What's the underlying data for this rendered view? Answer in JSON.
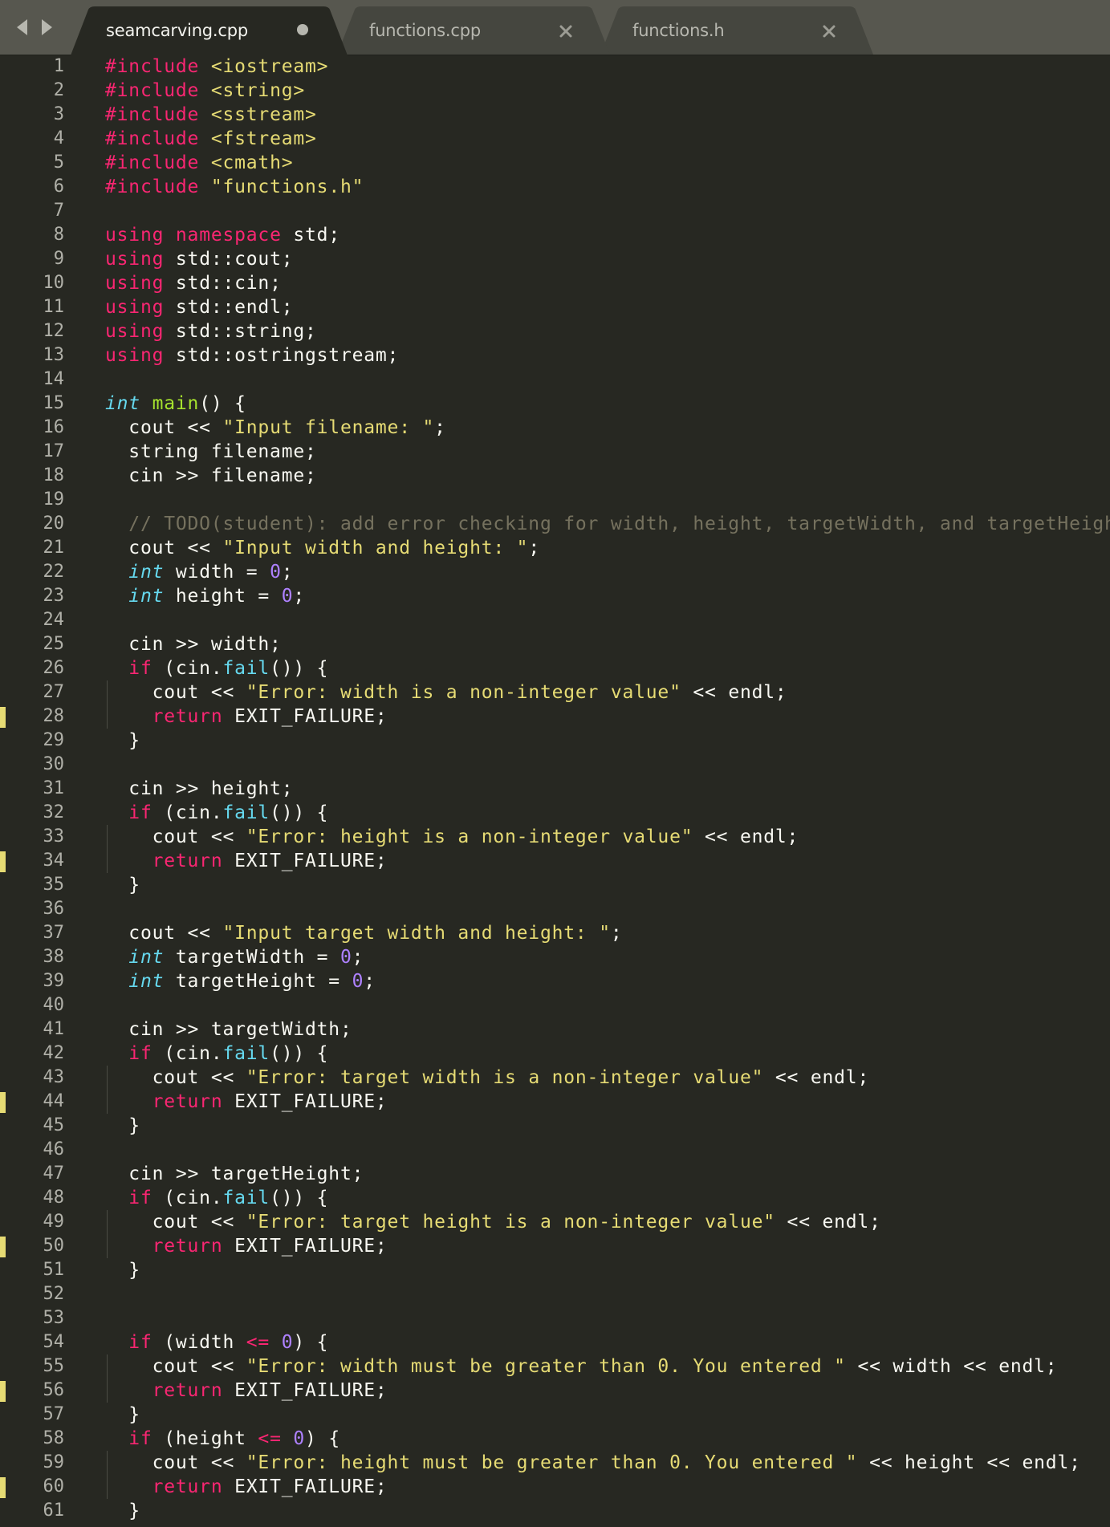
{
  "tabs": [
    {
      "label": "seamcarving.cpp",
      "active": true,
      "modified": true
    },
    {
      "label": "functions.cpp",
      "active": false,
      "modified": false
    },
    {
      "label": "functions.h",
      "active": false,
      "modified": false
    }
  ],
  "nav": {
    "back_icon": "triangle-left-icon",
    "forward_icon": "triangle-right-icon"
  },
  "colors": {
    "background": "#272822",
    "tabbar": "#57574f",
    "keyword": "#f92672",
    "string": "#e6db74",
    "type": "#66d9ef",
    "function": "#a6e22e",
    "number": "#ae81ff",
    "comment": "#75715e",
    "text": "#f8f8f2",
    "modified_marker": "#e6db74"
  },
  "code_lines": [
    {
      "n": "1",
      "mark": false,
      "tokens": [
        [
          "kw",
          "#include"
        ],
        [
          "p",
          " "
        ],
        [
          "str",
          "<iostream>"
        ]
      ]
    },
    {
      "n": "2",
      "mark": false,
      "tokens": [
        [
          "kw",
          "#include"
        ],
        [
          "p",
          " "
        ],
        [
          "str",
          "<string>"
        ]
      ]
    },
    {
      "n": "3",
      "mark": false,
      "tokens": [
        [
          "kw",
          "#include"
        ],
        [
          "p",
          " "
        ],
        [
          "str",
          "<sstream>"
        ]
      ]
    },
    {
      "n": "4",
      "mark": false,
      "tokens": [
        [
          "kw",
          "#include"
        ],
        [
          "p",
          " "
        ],
        [
          "str",
          "<fstream>"
        ]
      ]
    },
    {
      "n": "5",
      "mark": false,
      "tokens": [
        [
          "kw",
          "#include"
        ],
        [
          "p",
          " "
        ],
        [
          "str",
          "<cmath>"
        ]
      ]
    },
    {
      "n": "6",
      "mark": false,
      "tokens": [
        [
          "kw",
          "#include"
        ],
        [
          "p",
          " "
        ],
        [
          "str",
          "\"functions.h\""
        ]
      ]
    },
    {
      "n": "7",
      "mark": false,
      "tokens": []
    },
    {
      "n": "8",
      "mark": false,
      "tokens": [
        [
          "kw",
          "using"
        ],
        [
          "p",
          " "
        ],
        [
          "kw",
          "namespace"
        ],
        [
          "p",
          " std;"
        ]
      ]
    },
    {
      "n": "9",
      "mark": false,
      "tokens": [
        [
          "kw",
          "using"
        ],
        [
          "p",
          " std::cout;"
        ]
      ]
    },
    {
      "n": "10",
      "mark": false,
      "tokens": [
        [
          "kw",
          "using"
        ],
        [
          "p",
          " std::cin;"
        ]
      ]
    },
    {
      "n": "11",
      "mark": false,
      "tokens": [
        [
          "kw",
          "using"
        ],
        [
          "p",
          " std::endl;"
        ]
      ]
    },
    {
      "n": "12",
      "mark": false,
      "tokens": [
        [
          "kw",
          "using"
        ],
        [
          "p",
          " std::string;"
        ]
      ]
    },
    {
      "n": "13",
      "mark": false,
      "tokens": [
        [
          "kw",
          "using"
        ],
        [
          "p",
          " std::ostringstream;"
        ]
      ]
    },
    {
      "n": "14",
      "mark": false,
      "tokens": []
    },
    {
      "n": "15",
      "mark": false,
      "tokens": [
        [
          "type",
          "int"
        ],
        [
          "p",
          " "
        ],
        [
          "fn",
          "main"
        ],
        [
          "p",
          "() {"
        ]
      ]
    },
    {
      "n": "16",
      "mark": false,
      "tokens": [
        [
          "p",
          "  cout << "
        ],
        [
          "str",
          "\"Input filename: \""
        ],
        [
          "p",
          ";"
        ]
      ]
    },
    {
      "n": "17",
      "mark": false,
      "tokens": [
        [
          "p",
          "  string filename;"
        ]
      ]
    },
    {
      "n": "18",
      "mark": false,
      "tokens": [
        [
          "p",
          "  cin >> filename;"
        ]
      ]
    },
    {
      "n": "19",
      "mark": false,
      "tokens": []
    },
    {
      "n": "20",
      "mark": false,
      "tokens": [
        [
          "cm",
          "  // TODO(student): add error checking for width, height, targetWidth, and targetHeight"
        ]
      ]
    },
    {
      "n": "21",
      "mark": false,
      "tokens": [
        [
          "p",
          "  cout << "
        ],
        [
          "str",
          "\"Input width and height: \""
        ],
        [
          "p",
          ";"
        ]
      ]
    },
    {
      "n": "22",
      "mark": false,
      "tokens": [
        [
          "p",
          "  "
        ],
        [
          "type",
          "int"
        ],
        [
          "p",
          " width = "
        ],
        [
          "num",
          "0"
        ],
        [
          "p",
          ";"
        ]
      ]
    },
    {
      "n": "23",
      "mark": false,
      "tokens": [
        [
          "p",
          "  "
        ],
        [
          "type",
          "int"
        ],
        [
          "p",
          " height = "
        ],
        [
          "num",
          "0"
        ],
        [
          "p",
          ";"
        ]
      ]
    },
    {
      "n": "24",
      "mark": false,
      "tokens": []
    },
    {
      "n": "25",
      "mark": false,
      "tokens": [
        [
          "p",
          "  cin >> width;"
        ]
      ]
    },
    {
      "n": "26",
      "mark": false,
      "tokens": [
        [
          "p",
          "  "
        ],
        [
          "kw",
          "if"
        ],
        [
          "p",
          " (cin."
        ],
        [
          "call",
          "fail"
        ],
        [
          "p",
          "()) {"
        ]
      ]
    },
    {
      "n": "27",
      "mark": false,
      "tokens": [
        [
          "p",
          "    cout << "
        ],
        [
          "str",
          "\"Error: width is a non-integer value\""
        ],
        [
          "p",
          " << endl;"
        ]
      ]
    },
    {
      "n": "28",
      "mark": true,
      "tokens": [
        [
          "p",
          "    "
        ],
        [
          "kw",
          "return"
        ],
        [
          "p",
          " EXIT_FAILURE;"
        ]
      ]
    },
    {
      "n": "29",
      "mark": false,
      "tokens": [
        [
          "p",
          "  }"
        ]
      ]
    },
    {
      "n": "30",
      "mark": false,
      "tokens": []
    },
    {
      "n": "31",
      "mark": false,
      "tokens": [
        [
          "p",
          "  cin >> height;"
        ]
      ]
    },
    {
      "n": "32",
      "mark": false,
      "tokens": [
        [
          "p",
          "  "
        ],
        [
          "kw",
          "if"
        ],
        [
          "p",
          " (cin."
        ],
        [
          "call",
          "fail"
        ],
        [
          "p",
          "()) {"
        ]
      ]
    },
    {
      "n": "33",
      "mark": false,
      "tokens": [
        [
          "p",
          "    cout << "
        ],
        [
          "str",
          "\"Error: height is a non-integer value\""
        ],
        [
          "p",
          " << endl;"
        ]
      ]
    },
    {
      "n": "34",
      "mark": true,
      "tokens": [
        [
          "p",
          "    "
        ],
        [
          "kw",
          "return"
        ],
        [
          "p",
          " EXIT_FAILURE;"
        ]
      ]
    },
    {
      "n": "35",
      "mark": false,
      "tokens": [
        [
          "p",
          "  }"
        ]
      ]
    },
    {
      "n": "36",
      "mark": false,
      "tokens": []
    },
    {
      "n": "37",
      "mark": false,
      "tokens": [
        [
          "p",
          "  cout << "
        ],
        [
          "str",
          "\"Input target width and height: \""
        ],
        [
          "p",
          ";"
        ]
      ]
    },
    {
      "n": "38",
      "mark": false,
      "tokens": [
        [
          "p",
          "  "
        ],
        [
          "type",
          "int"
        ],
        [
          "p",
          " targetWidth = "
        ],
        [
          "num",
          "0"
        ],
        [
          "p",
          ";"
        ]
      ]
    },
    {
      "n": "39",
      "mark": false,
      "tokens": [
        [
          "p",
          "  "
        ],
        [
          "type",
          "int"
        ],
        [
          "p",
          " targetHeight = "
        ],
        [
          "num",
          "0"
        ],
        [
          "p",
          ";"
        ]
      ]
    },
    {
      "n": "40",
      "mark": false,
      "tokens": []
    },
    {
      "n": "41",
      "mark": false,
      "tokens": [
        [
          "p",
          "  cin >> targetWidth;"
        ]
      ]
    },
    {
      "n": "42",
      "mark": false,
      "tokens": [
        [
          "p",
          "  "
        ],
        [
          "kw",
          "if"
        ],
        [
          "p",
          " (cin."
        ],
        [
          "call",
          "fail"
        ],
        [
          "p",
          "()) {"
        ]
      ]
    },
    {
      "n": "43",
      "mark": false,
      "tokens": [
        [
          "p",
          "    cout << "
        ],
        [
          "str",
          "\"Error: target width is a non-integer value\""
        ],
        [
          "p",
          " << endl;"
        ]
      ]
    },
    {
      "n": "44",
      "mark": true,
      "tokens": [
        [
          "p",
          "    "
        ],
        [
          "kw",
          "return"
        ],
        [
          "p",
          " EXIT_FAILURE;"
        ]
      ]
    },
    {
      "n": "45",
      "mark": false,
      "tokens": [
        [
          "p",
          "  }"
        ]
      ]
    },
    {
      "n": "46",
      "mark": false,
      "tokens": []
    },
    {
      "n": "47",
      "mark": false,
      "tokens": [
        [
          "p",
          "  cin >> targetHeight;"
        ]
      ]
    },
    {
      "n": "48",
      "mark": false,
      "tokens": [
        [
          "p",
          "  "
        ],
        [
          "kw",
          "if"
        ],
        [
          "p",
          " (cin."
        ],
        [
          "call",
          "fail"
        ],
        [
          "p",
          "()) {"
        ]
      ]
    },
    {
      "n": "49",
      "mark": false,
      "tokens": [
        [
          "p",
          "    cout << "
        ],
        [
          "str",
          "\"Error: target height is a non-integer value\""
        ],
        [
          "p",
          " << endl;"
        ]
      ]
    },
    {
      "n": "50",
      "mark": true,
      "tokens": [
        [
          "p",
          "    "
        ],
        [
          "kw",
          "return"
        ],
        [
          "p",
          " EXIT_FAILURE;"
        ]
      ]
    },
    {
      "n": "51",
      "mark": false,
      "tokens": [
        [
          "p",
          "  }"
        ]
      ]
    },
    {
      "n": "52",
      "mark": false,
      "tokens": []
    },
    {
      "n": "53",
      "mark": false,
      "tokens": []
    },
    {
      "n": "54",
      "mark": false,
      "tokens": [
        [
          "p",
          "  "
        ],
        [
          "kw",
          "if"
        ],
        [
          "p",
          " (width "
        ],
        [
          "kw",
          "<="
        ],
        [
          "p",
          " "
        ],
        [
          "num",
          "0"
        ],
        [
          "p",
          ") {"
        ]
      ]
    },
    {
      "n": "55",
      "mark": false,
      "tokens": [
        [
          "p",
          "    cout << "
        ],
        [
          "str",
          "\"Error: width must be greater than 0. You entered \""
        ],
        [
          "p",
          " << width << endl;"
        ]
      ]
    },
    {
      "n": "56",
      "mark": true,
      "tokens": [
        [
          "p",
          "    "
        ],
        [
          "kw",
          "return"
        ],
        [
          "p",
          " EXIT_FAILURE;"
        ]
      ]
    },
    {
      "n": "57",
      "mark": false,
      "tokens": [
        [
          "p",
          "  }"
        ]
      ]
    },
    {
      "n": "58",
      "mark": false,
      "tokens": [
        [
          "p",
          "  "
        ],
        [
          "kw",
          "if"
        ],
        [
          "p",
          " (height "
        ],
        [
          "kw",
          "<="
        ],
        [
          "p",
          " "
        ],
        [
          "num",
          "0"
        ],
        [
          "p",
          ") {"
        ]
      ]
    },
    {
      "n": "59",
      "mark": false,
      "tokens": [
        [
          "p",
          "    cout << "
        ],
        [
          "str",
          "\"Error: height must be greater than 0. You entered \""
        ],
        [
          "p",
          " << height << endl;"
        ]
      ]
    },
    {
      "n": "60",
      "mark": true,
      "tokens": [
        [
          "p",
          "    "
        ],
        [
          "kw",
          "return"
        ],
        [
          "p",
          " EXIT_FAILURE;"
        ]
      ]
    },
    {
      "n": "61",
      "mark": false,
      "tokens": [
        [
          "p",
          "  }"
        ]
      ]
    }
  ]
}
